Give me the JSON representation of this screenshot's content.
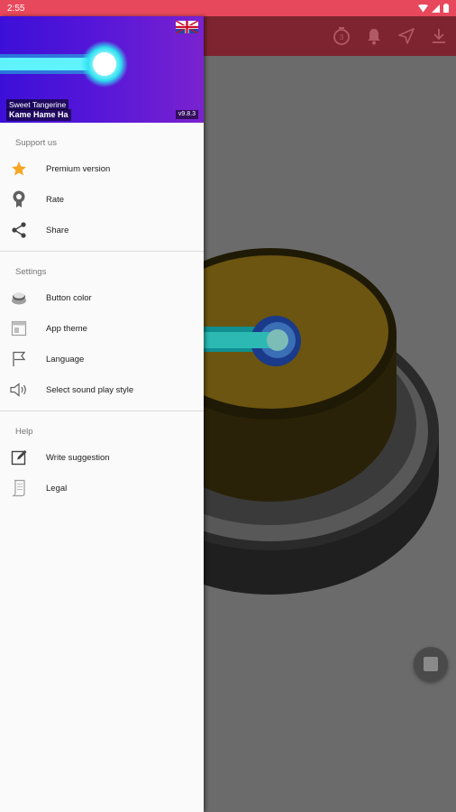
{
  "status": {
    "time": "2:55"
  },
  "drawer": {
    "header": {
      "song": "Sweet Tangerine",
      "artist": "Kame Hame Ha",
      "version": "v9.8.3"
    },
    "sections": [
      {
        "title": "Support us",
        "items": [
          {
            "label": "Premium version",
            "icon": "star-icon"
          },
          {
            "label": "Rate",
            "icon": "award-icon"
          },
          {
            "label": "Share",
            "icon": "share-icon"
          }
        ]
      },
      {
        "title": "Settings",
        "items": [
          {
            "label": "Button color",
            "icon": "button-color-icon"
          },
          {
            "label": "App theme",
            "icon": "app-theme-icon"
          },
          {
            "label": "Language",
            "icon": "flag-icon"
          },
          {
            "label": "Select sound play style",
            "icon": "volume-icon"
          }
        ]
      },
      {
        "title": "Help",
        "items": [
          {
            "label": "Write suggestion",
            "icon": "edit-icon"
          },
          {
            "label": "Legal",
            "icon": "document-icon"
          }
        ]
      }
    ]
  },
  "appbar": {
    "actions": [
      "timer-icon",
      "bell-icon",
      "send-icon",
      "download-icon"
    ]
  },
  "colors": {
    "statusbar": "#e8485c",
    "appbar_dimmed": "#7d2430",
    "star": "#f6a623",
    "button_top": "#6b5510"
  }
}
